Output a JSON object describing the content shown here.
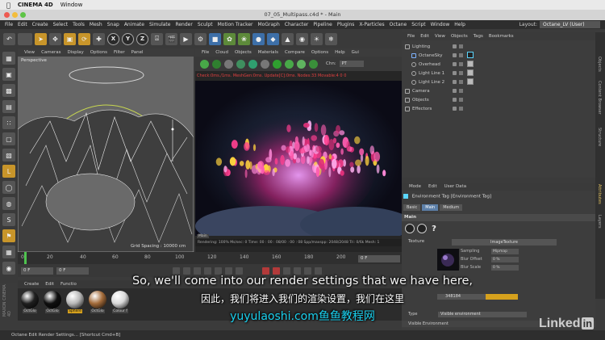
{
  "mac_menubar": {
    "app": "CINEMA 4D",
    "items": [
      "Window"
    ]
  },
  "window_title": "07_05_Multipass.c4d * - Main",
  "c4d_menu": [
    "File",
    "Edit",
    "Create",
    "Select",
    "Tools",
    "Mesh",
    "Snap",
    "Animate",
    "Simulate",
    "Render",
    "Sculpt",
    "Motion Tracker",
    "MoGraph",
    "Character",
    "Pipeline",
    "Plugins",
    "X-Particles",
    "Octane",
    "Script",
    "Window",
    "Help"
  ],
  "layout": {
    "label": "Layout:",
    "value": "Octane_LV (User)"
  },
  "axis_buttons": [
    "X",
    "Y",
    "Z"
  ],
  "viewport": {
    "menu": [
      "View",
      "Cameras",
      "Display",
      "Options",
      "Filter",
      "Panel"
    ],
    "label": "Perspective",
    "grid_spacing": "Grid Spacing : 10000 cm"
  },
  "octane_viewer": {
    "menu": [
      "File",
      "Cloud",
      "Objects",
      "Materials",
      "Compare",
      "Options",
      "Help",
      "Gui"
    ],
    "channel_label": "Chn:",
    "channel_value": "PT",
    "render_info": "Check:0ms./1ms. MeshGen:0ms. Update[C]:0ms. Nodes:33 Movable:4  0 0",
    "status": "Rendering: 100%  Ms/sec: 0   Time: 00 : 00 : 08/00 : 00 : 08    Spp/maxspp: 2048/2048   Tri: 0/6k   Mesh: 1",
    "main_button": "Main"
  },
  "timeline": {
    "ticks": [
      "0",
      "20",
      "40",
      "60",
      "80",
      "100",
      "120",
      "140",
      "160",
      "180",
      "200"
    ],
    "end_frame": "0 F",
    "start_field": "0 F",
    "start_field2": "0 F"
  },
  "material_manager": {
    "menu": [
      "Create",
      "Edit",
      "Functio"
    ],
    "materials": [
      {
        "name": "OctGlo",
        "color": "#1f1f1f"
      },
      {
        "name": "OctGlo",
        "color": "#0f0f0f"
      },
      {
        "name": "Sphere",
        "color": "#b8b8b8",
        "selected": true
      },
      {
        "name": "OctGlo",
        "color": "#a36b3a"
      },
      {
        "name": "Colour f",
        "color": "#d8d8d8"
      }
    ],
    "brand": "MAXON CINEMA 4D"
  },
  "object_manager": {
    "menu": [
      "File",
      "Edit",
      "View",
      "Objects",
      "Tags",
      "Bookmarks"
    ],
    "items": [
      {
        "name": "Lighting",
        "indent": 0
      },
      {
        "name": "OctaneSky",
        "indent": 1
      },
      {
        "name": "Overhead",
        "indent": 1
      },
      {
        "name": "Light Line 1",
        "indent": 1
      },
      {
        "name": "Light Line 2",
        "indent": 1
      },
      {
        "name": "Camera",
        "indent": 0
      },
      {
        "name": "Objects",
        "indent": 0
      },
      {
        "name": "Effectors",
        "indent": 0
      }
    ]
  },
  "side_tabs": [
    "Objects",
    "Content Browser",
    "Structure",
    "Attributes",
    "Layers"
  ],
  "attributes": {
    "menu": [
      "Mode",
      "Edit",
      "User Data"
    ],
    "title": "Environment Tag [Environment Tag]",
    "tabs": [
      "Basic",
      "Main",
      "Medium"
    ],
    "active_tab": "Main",
    "section": "Main",
    "texture_label": "Texture",
    "texture_button": "ImageTexture",
    "props": [
      {
        "label": "Sampling",
        "value": "Mipmap"
      },
      {
        "label": "Blur Offset",
        "value": "0 %"
      },
      {
        "label": "Blur Scale",
        "value": "0 %"
      }
    ],
    "res_value": "348184",
    "type_label": "Type",
    "type_value": "Visible environment",
    "visible_env": "Visible Environment"
  },
  "statusbar": "Octane   Edit Render Settings... [Shortcut Cmd+B]",
  "subtitles": {
    "en": "So, we'll come into our render settings that we have here,",
    "zh": "因此，我们将进入我们的渲染设置，我们在这里",
    "watermark": "yuyulaoshi.com鱼鱼教程网"
  },
  "brand_watermark": {
    "text": "Linked",
    "badge": "in"
  }
}
